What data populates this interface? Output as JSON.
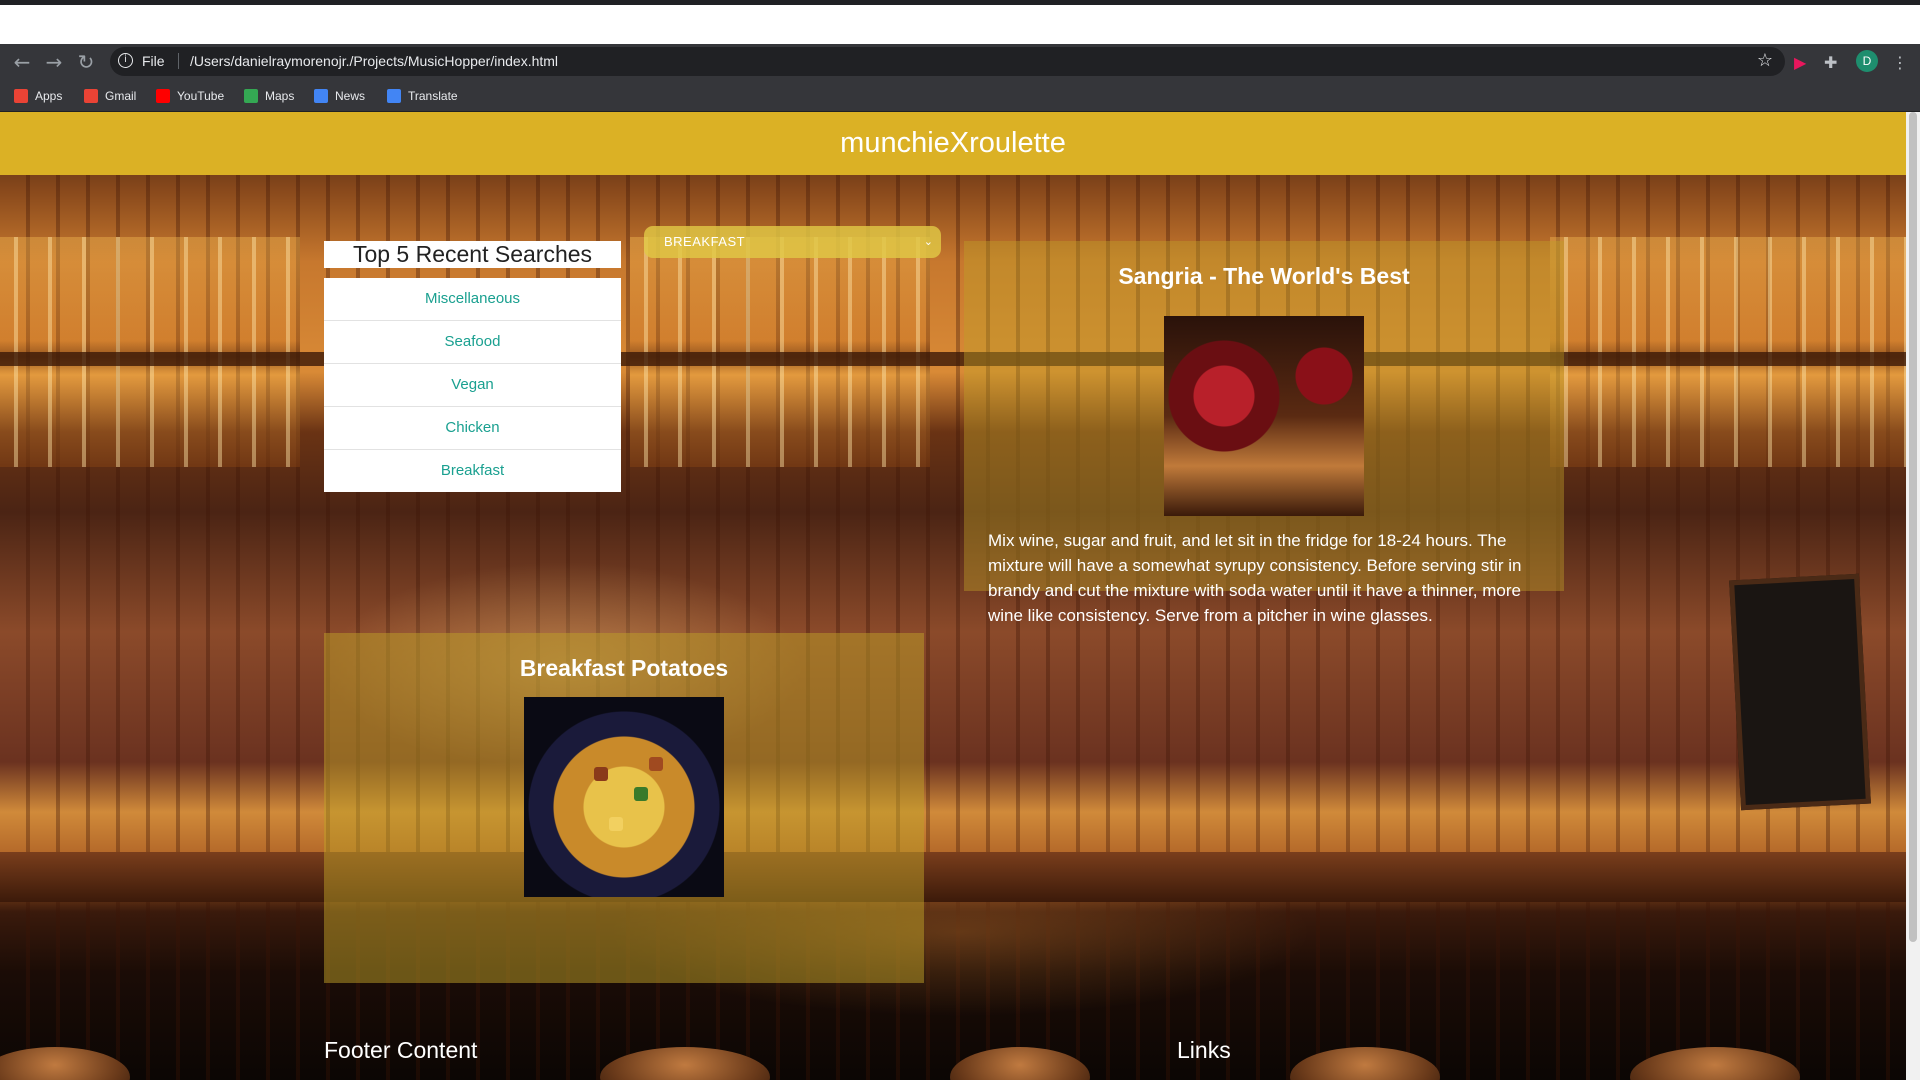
{
  "browser": {
    "url_scheme": "File",
    "url": "/Users/danielraymorenojr./Projects/MusicHopper/index.html",
    "profile_initial": "D",
    "bookmarks": [
      {
        "label": "Apps",
        "color": "#ea4335"
      },
      {
        "label": "Gmail",
        "color": "#ea4335"
      },
      {
        "label": "YouTube",
        "color": "#ff0000"
      },
      {
        "label": "Maps",
        "color": "#34a853"
      },
      {
        "label": "News",
        "color": "#4285f4"
      },
      {
        "label": "Translate",
        "color": "#4285f4"
      }
    ]
  },
  "app": {
    "brand": "munchieXroulette",
    "brand_color": "#dbb125",
    "accent_link_color": "#1aa090"
  },
  "recent": {
    "title": "Top 5 Recent Searches",
    "items": [
      "Miscellaneous",
      "Seafood",
      "Vegan",
      "Chicken",
      "Breakfast"
    ]
  },
  "category_select": {
    "value": "BREAKFAST"
  },
  "drink_card": {
    "title": "Sangria - The World's Best",
    "description": "Mix wine, sugar and fruit, and let sit in the fridge for 18-24 hours. The mixture will have a somewhat syrupy consistency. Before serving stir in brandy and cut the mixture with soda water until it have a thinner, more wine like consistency. Serve from a pitcher in wine glasses."
  },
  "food_card": {
    "title": "Breakfast Potatoes"
  },
  "footer": {
    "content_heading": "Footer Content",
    "links_heading": "Links"
  }
}
